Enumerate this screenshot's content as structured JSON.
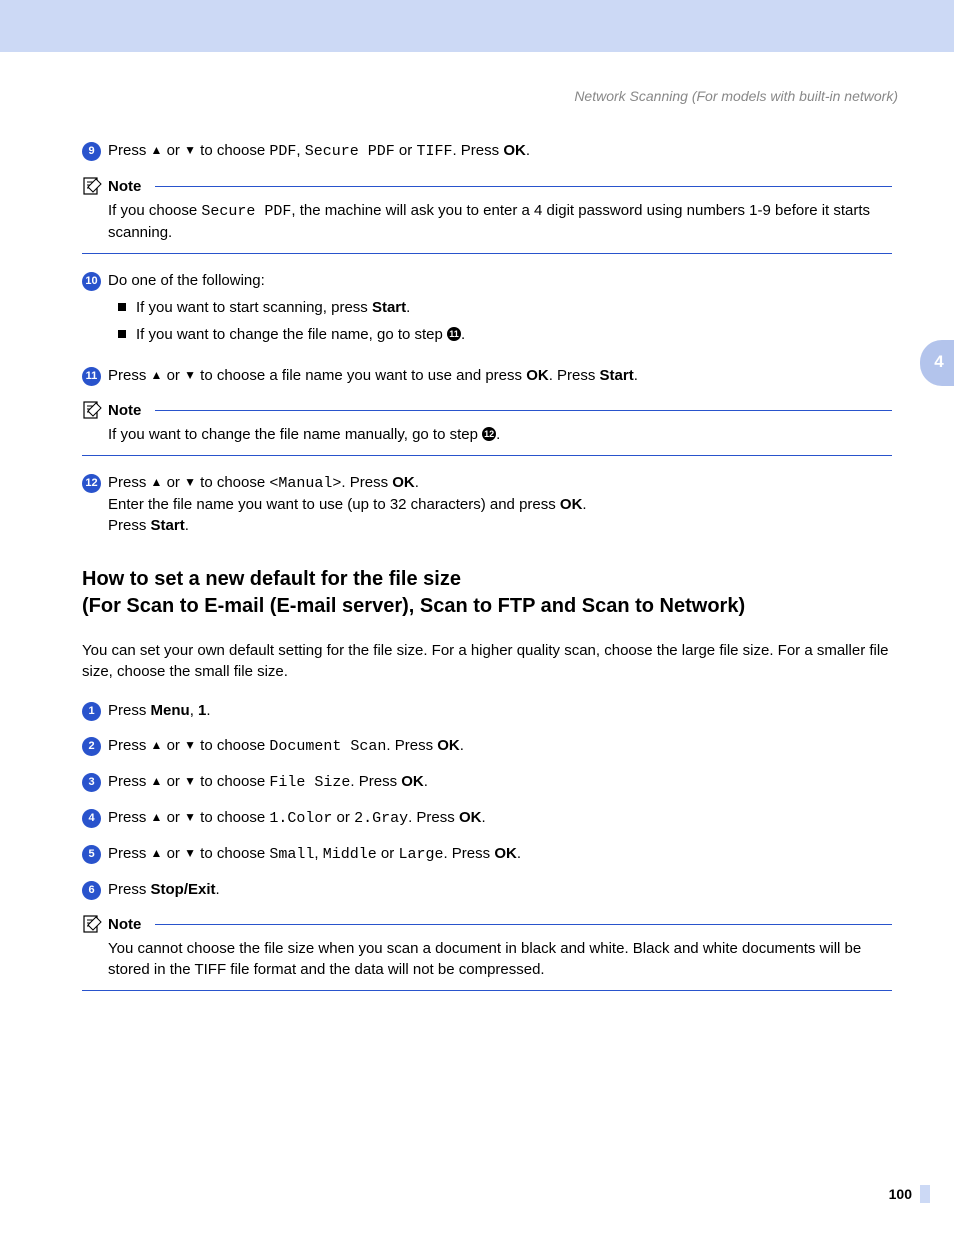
{
  "header": "Network Scanning (For models with built-in network)",
  "chapter_tab": "4",
  "page_number": "100",
  "step9": {
    "num": "9",
    "t1": "Press ",
    "t2": " or ",
    "t3": " to choose ",
    "opt1": "PDF",
    "comma1": ", ",
    "opt2": "Secure PDF",
    "or1": " or ",
    "opt3": "TIFF",
    "t4": ". Press ",
    "ok": "OK",
    "dot": "."
  },
  "note1": {
    "label": "Note",
    "t1": "If you choose ",
    "mono": "Secure PDF",
    "t2": ", the machine will ask you to enter a 4 digit password using numbers 1-9 before it starts scanning."
  },
  "step10": {
    "num": "10",
    "intro": "Do one of the following:",
    "b1a": "If you want to start scanning, press ",
    "b1b": "Start",
    "b1c": ".",
    "b2a": "If you want to change the file name, go to step ",
    "b2ref": "11",
    "b2c": "."
  },
  "step11": {
    "num": "11",
    "t1": "Press ",
    "t2": " or ",
    "t3": " to choose a file name you want to use and press ",
    "ok": "OK",
    "t4": ". Press ",
    "start": "Start",
    "dot": "."
  },
  "note2": {
    "label": "Note",
    "t1": "If you want to change the file name manually, go to step ",
    "ref": "12",
    "dot": "."
  },
  "step12": {
    "num": "12",
    "l1a": "Press ",
    "l1b": " or ",
    "l1c": " to choose ",
    "manual": "<Manual>",
    "l1d": ". Press ",
    "ok": "OK",
    "l1e": ".",
    "l2a": "Enter the file name you want to use (up to 32 characters) and press ",
    "l2b": "OK",
    "l2c": ".",
    "l3a": "Press ",
    "l3b": "Start",
    "l3c": "."
  },
  "section": {
    "line1": "How to set a new default for the file size",
    "line2": "(For Scan to E-mail (E-mail server), Scan to FTP and Scan to Network)"
  },
  "intro": "You can set your own default setting for the file size. For a higher quality scan, choose the large file size. For a smaller file size, choose the small file size.",
  "s1": {
    "num": "1",
    "a": "Press ",
    "b": "Menu",
    "c": ", ",
    "d": "1",
    "e": "."
  },
  "s2": {
    "num": "2",
    "a": "Press ",
    "b": " or ",
    "c": " to choose ",
    "mono": "Document Scan",
    "d": ". Press ",
    "ok": "OK",
    "e": "."
  },
  "s3": {
    "num": "3",
    "a": "Press ",
    "b": " or ",
    "c": " to choose ",
    "mono": "File Size",
    "d": ". Press ",
    "ok": "OK",
    "e": "."
  },
  "s4": {
    "num": "4",
    "a": "Press ",
    "b": " or ",
    "c": " to choose ",
    "m1": "1.Color",
    "or": " or ",
    "m2": "2.Gray",
    "d": ". Press ",
    "ok": "OK",
    "e": "."
  },
  "s5": {
    "num": "5",
    "a": "Press ",
    "b": " or ",
    "c": " to choose ",
    "m1": "Small",
    "c1": ", ",
    "m2": "Middle",
    "or": " or ",
    "m3": "Large",
    "d": ". Press ",
    "ok": "OK",
    "e": "."
  },
  "s6": {
    "num": "6",
    "a": "Press ",
    "b": "Stop/Exit",
    "c": "."
  },
  "note3": {
    "label": "Note",
    "body": "You cannot choose the file size when you scan a document in black and white. Black and white documents will be stored in the TIFF file format and the data will not be compressed."
  }
}
